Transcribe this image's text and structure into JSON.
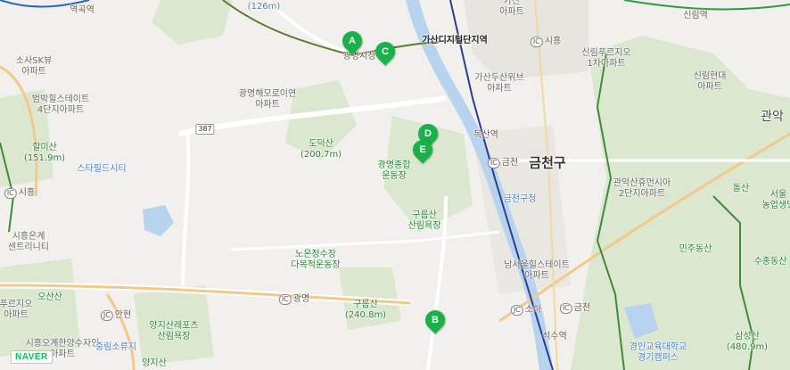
{
  "map": {
    "markers": [
      "A",
      "B",
      "C",
      "D",
      "E"
    ],
    "district": "금천구",
    "labels": {
      "hospital_top": "(126m)",
      "station_yeokgok": "역곡역",
      "apt_sosa_sk": "소사SK뷰\n아파트",
      "apt_beomback": "범박힐스테이트\n4단지아파트",
      "mountain_halmi": "할미산\n(151.9m)",
      "starfield": "스타필드시티",
      "ic_siheung_left": "시흥",
      "siheung_eungye": "시흥은계\n센트리니티",
      "apt_prugio": "푸르지오\n아파트",
      "mountain_osan": "오산산",
      "jc_anhyeon": "안현",
      "apt_siheung_gyeongmi": "시흥오계한양수자인\n아파트",
      "junglim": "중림소류지",
      "mountain_gyeokjinsan": "양지산레포츠\n산림욕장",
      "mountain_yangji": "양지산",
      "apt_gwangmyeong_hemoro": "광명해모로이연\n아파트",
      "mountain_dodeok": "도덕산\n(200.7m)",
      "road_387": "387",
      "gwangmyeong_cityhall": "광명시청",
      "gasan_station": "가산디지털단지역",
      "gwangmyeong_stadium": "광명종합\n운동장",
      "gureumsan_forest": "구름산\n산림욕장",
      "noonjeong": "노온정수장\n다목적운동장",
      "ic_gwangmyeong": "광명",
      "mountain_gureum": "구름산\n(240.8m)",
      "doksan_station": "독산역",
      "ic_geumcheon": "금천",
      "geumcheon_office": "금천구청",
      "apt_namseoul": "남서울힐스테이트\n아파트",
      "jc_soha": "소하",
      "ic_geumcheon2": "금천",
      "seoksu_station": "석수역",
      "apt_gasan_doosan": "가산두산위브\n아파트",
      "ic_siheung_right": "시흥",
      "apt_sillim_prugio": "신림푸르지오\n1차아파트",
      "sillim_station": "신림역",
      "apt_sillim_hyundai": "신림현대\n아파트",
      "apt_gwanak_sanho": "관악산휴먼시아\n2단지아파트",
      "mountain_dolsan": "돌산",
      "minju_park": "민주동산",
      "gwanak_mtn_partial": "관악",
      "seoul_forest": "서울\n농업생명",
      "sujong_partial": "수종동산",
      "gyeongin_univ": "경인교육대학교\n경기캠퍼스",
      "mountain_samseong": "삼성산\n(480.9m)",
      "apt_gasan_top": "가산\n아파트"
    },
    "brand": "NAVER"
  }
}
